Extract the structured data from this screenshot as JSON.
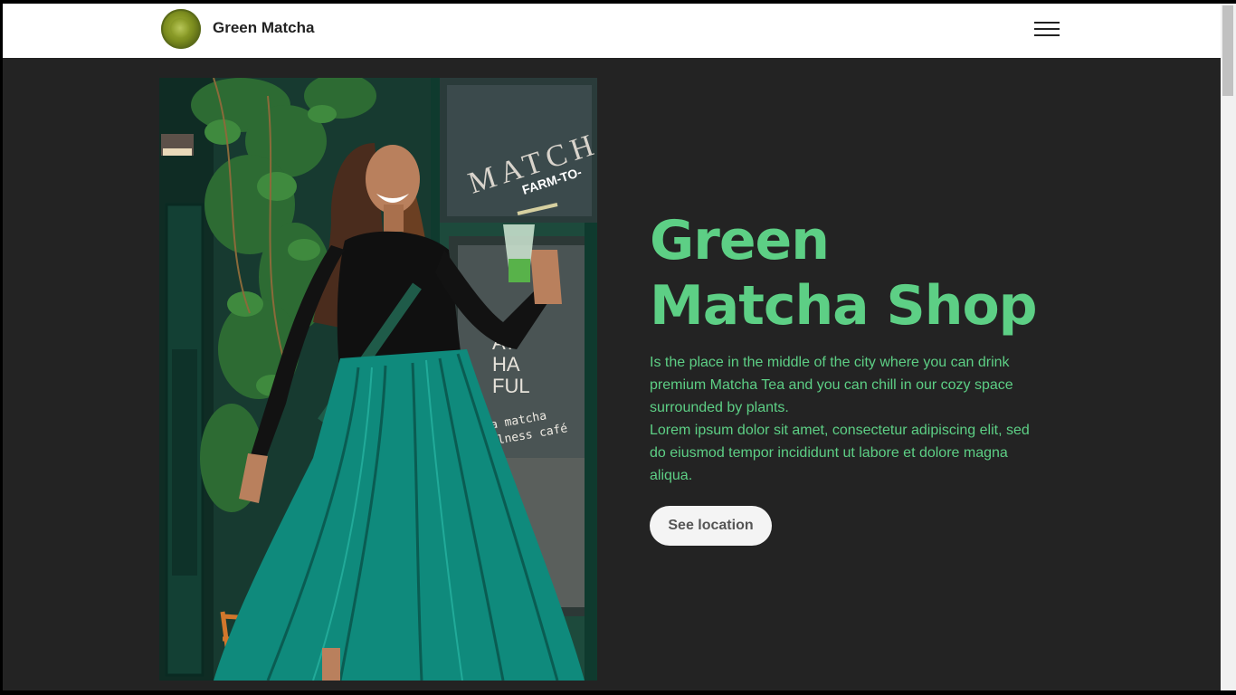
{
  "navbar": {
    "brand_name": "Green Matcha",
    "logo_icon": "matcha-bowl-logo",
    "menu_icon": "hamburger-menu-icon"
  },
  "hero": {
    "title_line1": "Green",
    "title_line2": "Matcha Shop",
    "paragraph1": "Is the place in the middle of the city where you can drink premium Matcha Tea and you can chill in our cozy space surrounded by plants.",
    "paragraph2": "Lorem ipsum dolor sit amet, consectetur adipiscing elit, sed do eiusmod tempor incididunt ut labore et dolore magna aliqua.",
    "cta_label": "See location",
    "photo_sign_text": "MATCH",
    "photo_sign_sub": "FARM-TO-",
    "photo_window_text_1": "AT",
    "photo_window_text_2": "HA",
    "photo_window_text_3": "FUL",
    "photo_window_text_4": "a matcha",
    "photo_window_text_5": "wellness café"
  },
  "colors": {
    "accent": "#5dcf85",
    "background": "#232323",
    "navbar_bg": "#ffffff"
  }
}
